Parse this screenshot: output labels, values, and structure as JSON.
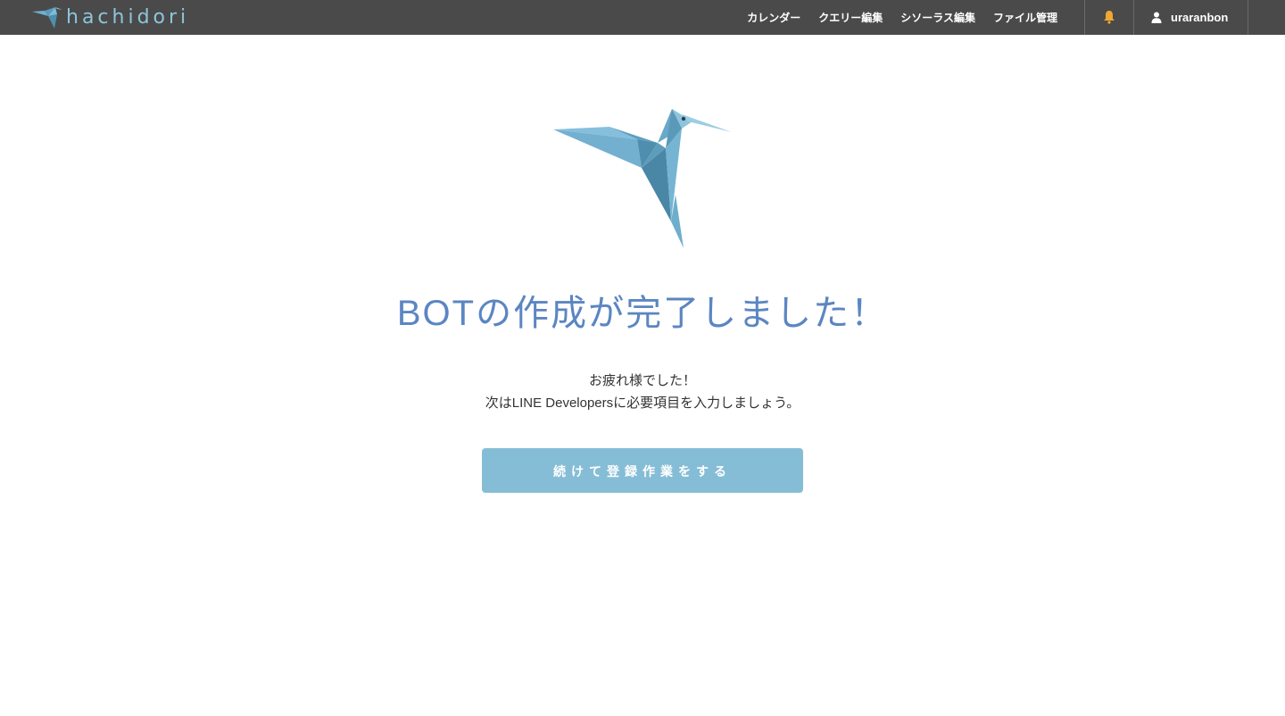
{
  "header": {
    "logo_text": "hachidori",
    "logo_icon": "hummingbird-icon",
    "nav": [
      {
        "label": "カレンダー"
      },
      {
        "label": "クエリー編集"
      },
      {
        "label": "シソーラス編集"
      },
      {
        "label": "ファイル管理"
      }
    ],
    "notification_icon": "bell-icon",
    "user_icon": "user-icon",
    "username": "uraranbon"
  },
  "main": {
    "illustration": "origami-hummingbird",
    "title": "BOTの作成が完了しました！",
    "message_line1": "お疲れ様でした！",
    "message_line2": "次はLINE Developersに必要項目を入力しましょう。",
    "continue_button": "続けて登録作業をする"
  },
  "colors": {
    "header_bg": "#4a4a4a",
    "logo": "#8ec4dc",
    "title": "#5b86c2",
    "button_bg": "#86bdd6",
    "bell": "#f0a830"
  }
}
